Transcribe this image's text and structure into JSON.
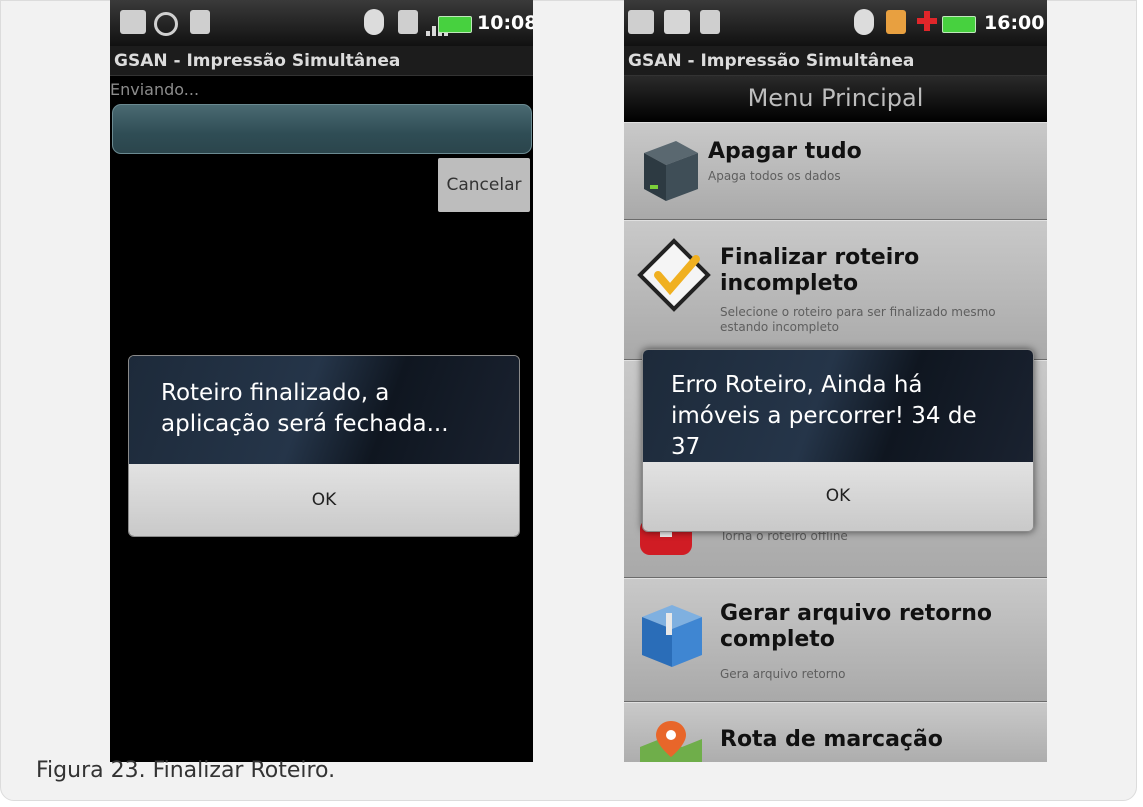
{
  "phone_left": {
    "status_time": "10:08",
    "app_title": "GSAN - Impressão Simultânea",
    "status_text": "Enviando...",
    "cancel_label": "Cancelar",
    "dialog_message": "Roteiro finalizado, a aplicação será fechada...",
    "dialog_ok": "OK"
  },
  "phone_right": {
    "status_time": "16:00",
    "app_title": "GSAN - Impressão Simultânea",
    "menu_title": "Menu Principal",
    "menu_items": [
      {
        "title": "Apagar tudo",
        "subtitle": "Apaga todos os dados",
        "icon": "box-icon"
      },
      {
        "title": "Finalizar roteiro incompleto",
        "subtitle": "Selecione o roteiro para ser finalizado mesmo estando incompleto",
        "icon": "checkmark-icon"
      },
      {
        "title": "",
        "subtitle": "Torna o roteiro offline",
        "icon": "offline-icon"
      },
      {
        "title": "Gerar arquivo retorno completo",
        "subtitle": "Gera arquivo retorno",
        "icon": "package-icon"
      },
      {
        "title": "Rota de marcação",
        "subtitle": "",
        "icon": "map-pin-icon"
      }
    ],
    "dialog_message": "Erro Roteiro, Ainda há imóveis a percorrer! 34 de 37",
    "dialog_ok": "OK"
  },
  "caption": "Figura 23. Finalizar Roteiro.",
  "colors": {
    "battery": "#47d13f",
    "progress_bar": "#3b5a62",
    "dialog_bg": "#1d2a3a"
  }
}
